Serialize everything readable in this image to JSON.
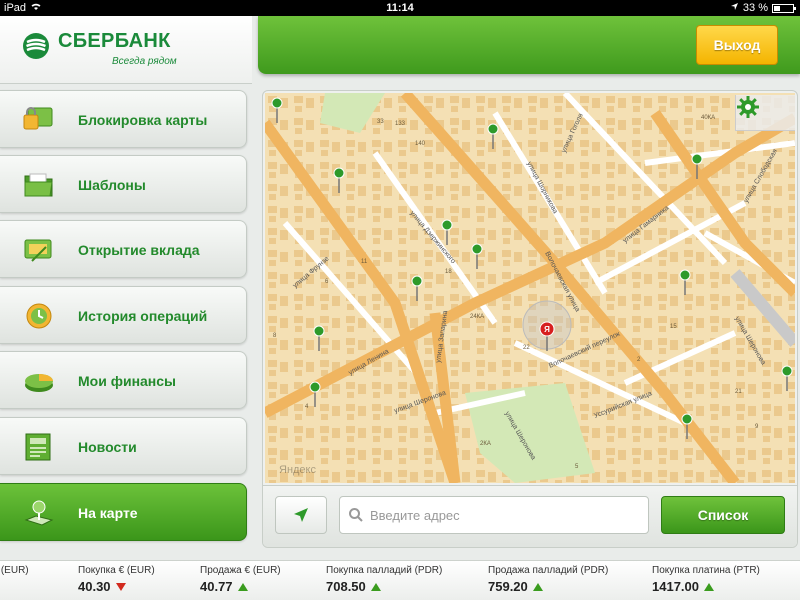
{
  "status_bar": {
    "device": "iPad",
    "time": "11:14",
    "battery": "33 %",
    "battery_level": 0.33
  },
  "header": {
    "bank_name": "СБЕРБАНК",
    "tagline": "Всегда рядом",
    "exit_label": "Выход"
  },
  "colors": {
    "brand_green": "#3f9a1d",
    "exit_yellow": "#f4b400",
    "pin_green": "#2e9a2a",
    "marker_red": "#d71f1f"
  },
  "sidebar": {
    "items": [
      {
        "label": "Блокировка карты",
        "icon": "card-lock-icon",
        "active": false
      },
      {
        "label": "Шаблоны",
        "icon": "folder-icon",
        "active": false
      },
      {
        "label": "Открытие вклада",
        "icon": "deposit-icon",
        "active": false
      },
      {
        "label": "История операций",
        "icon": "history-icon",
        "active": false
      },
      {
        "label": "Мои финансы",
        "icon": "pie-chart-icon",
        "active": false
      },
      {
        "label": "Новости",
        "icon": "news-icon",
        "active": false
      },
      {
        "label": "На карте",
        "icon": "map-pin-icon",
        "active": true
      }
    ]
  },
  "map": {
    "streets": [
      "улица Гоголя",
      "улица Шорникова",
      "улица Ленина",
      "улица Гамарника",
      "улица Слободская",
      "улица Фрунзе",
      "улица Дзержинского",
      "улица Шеронова",
      "Волочаевская улица",
      "Волочаевский переулок",
      "улица Запарина",
      "улица Шеронова",
      "Уссурийская улица",
      "улица Шеронова"
    ],
    "house_numbers": [
      "133",
      "140",
      "40КА",
      "6",
      "2",
      "4",
      "21",
      "24КА",
      "22",
      "2КА",
      "15",
      "11",
      "8",
      "33",
      "5",
      "9",
      "18"
    ],
    "watermark": "Яндекс",
    "marker_label": "Я",
    "settings_icon": "gear-icon"
  },
  "map_footer": {
    "search_placeholder": "Введите адрес",
    "list_label": "Список",
    "locate_icon": "location-arrow-icon"
  },
  "ticker": [
    {
      "label": "Продажа € (EUR)",
      "value": "",
      "trend": ""
    },
    {
      "label": "Покупка € (EUR)",
      "value": "40.30",
      "trend": "down"
    },
    {
      "label": "Продажа € (EUR)",
      "value": "40.77",
      "trend": "up"
    },
    {
      "label": "Покупка палладий (PDR)",
      "value": "708.50",
      "trend": "up"
    },
    {
      "label": "Продажа палладий (PDR)",
      "value": "759.20",
      "trend": "up"
    },
    {
      "label": "Покупка платина (PTR)",
      "value": "1417.00",
      "trend": "up"
    }
  ]
}
